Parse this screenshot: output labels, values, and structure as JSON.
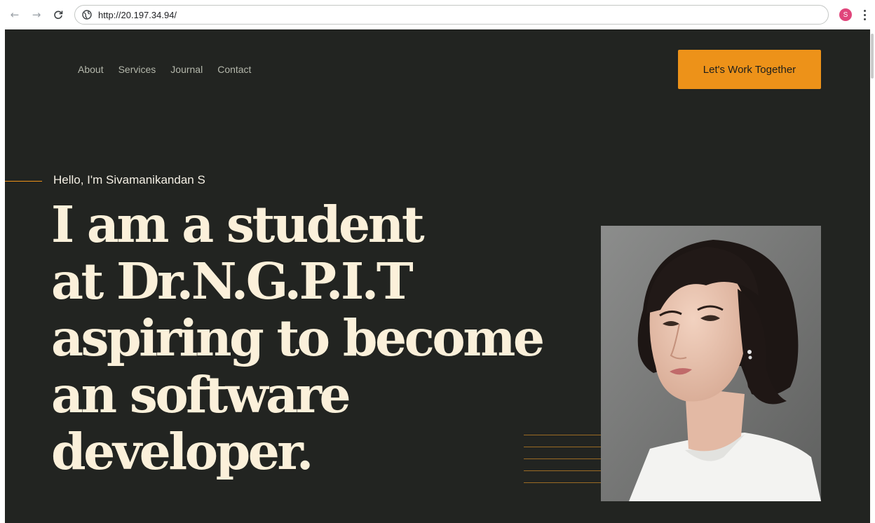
{
  "browser": {
    "url": "http://20.197.34.94/",
    "profile_initial": "S"
  },
  "site": {
    "nav": [
      "About",
      "Services",
      "Journal",
      "Contact"
    ],
    "cta_label": "Let's Work Together",
    "hello": "Hello, I'm Sivamanikandan S",
    "headline": [
      "I am a student",
      "at Dr.N.G.P.I.T",
      "aspiring to become",
      "an software",
      "developer."
    ],
    "portrait_alt": "portrait-photo",
    "colors": {
      "background": "#222421",
      "accent": "#ed9219",
      "headline": "#fbf0da",
      "nav_text": "#b4b7ab"
    }
  }
}
